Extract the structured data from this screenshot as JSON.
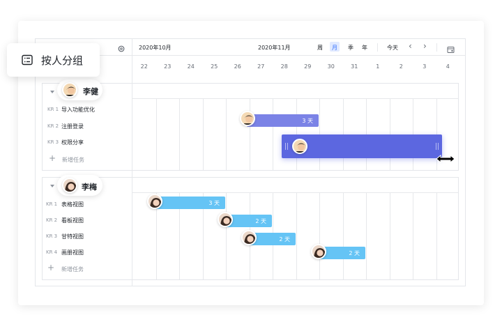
{
  "toolbar": {
    "month_left": "2020年10月",
    "month_right": "2020年11月",
    "views": [
      {
        "label": "周",
        "active": false
      },
      {
        "label": "月",
        "active": true
      },
      {
        "label": "季",
        "active": false
      },
      {
        "label": "年",
        "active": false
      }
    ],
    "today_label": "今天",
    "prev_icon": "‹",
    "next_icon": "›"
  },
  "floating_button": {
    "label": "按人分组",
    "icon": "list-icon"
  },
  "days": [
    "22",
    "23",
    "24",
    "25",
    "26",
    "27",
    "28",
    "29",
    "30",
    "31",
    "1",
    "2",
    "3",
    "4"
  ],
  "groups": [
    {
      "owner": "李健",
      "tasks": [
        {
          "id": "KR 1",
          "name": "导入功能优化",
          "bar_label": "3 天"
        },
        {
          "id": "KR 2",
          "name": "注册登录"
        },
        {
          "id": "KR 3",
          "name": "权限分享"
        }
      ],
      "add_label": "新增任务"
    },
    {
      "owner": "李梅",
      "tasks": [
        {
          "id": "KR 1",
          "name": "表格视图",
          "bar_label": "3 天"
        },
        {
          "id": "KR 2",
          "name": "看板视图",
          "bar_label": "2 天"
        },
        {
          "id": "KR 3",
          "name": "甘特视图",
          "bar_label": "2 天"
        },
        {
          "id": "KR 4",
          "name": "画册视图",
          "bar_label": "2 天"
        }
      ],
      "add_label": "新增任务"
    }
  ],
  "colors": {
    "purple_bar": "#7b83e6",
    "purple_bar_dark": "#5c67e0",
    "blue_bar": "#65c4f5",
    "accent": "#3370ff"
  }
}
